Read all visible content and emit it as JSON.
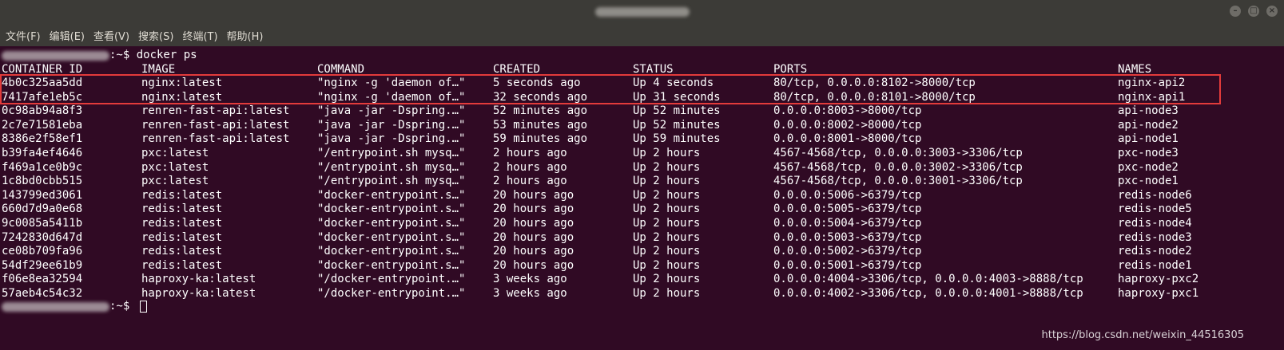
{
  "menu": [
    "文件(F)",
    "编辑(E)",
    "查看(V)",
    "搜索(S)",
    "终端(T)",
    "帮助(H)"
  ],
  "window_controls": {
    "minimize": "–",
    "maximize": "□",
    "close": "×"
  },
  "prompt": {
    "suffix": ":~$ ",
    "command": "docker ps"
  },
  "table": {
    "headers": [
      "CONTAINER ID",
      "IMAGE",
      "COMMAND",
      "CREATED",
      "STATUS",
      "PORTS",
      "NAMES"
    ],
    "rows": [
      [
        "4b0c325aa5dd",
        "nginx:latest",
        "\"nginx -g 'daemon of…\"",
        "5 seconds ago",
        "Up 4 seconds",
        "80/tcp, 0.0.0.0:8102->8000/tcp",
        "nginx-api2"
      ],
      [
        "7417afe1eb5c",
        "nginx:latest",
        "\"nginx -g 'daemon of…\"",
        "32 seconds ago",
        "Up 31 seconds",
        "80/tcp, 0.0.0.0:8101->8000/tcp",
        "nginx-api1"
      ],
      [
        "0c98ab94a8f3",
        "renren-fast-api:latest",
        "\"java -jar -Dspring.…\"",
        "52 minutes ago",
        "Up 52 minutes",
        "0.0.0.0:8003->8000/tcp",
        "api-node3"
      ],
      [
        "2c7e71581eba",
        "renren-fast-api:latest",
        "\"java -jar -Dspring.…\"",
        "53 minutes ago",
        "Up 52 minutes",
        "0.0.0.0:8002->8000/tcp",
        "api-node2"
      ],
      [
        "8386e2f58ef1",
        "renren-fast-api:latest",
        "\"java -jar -Dspring.…\"",
        "59 minutes ago",
        "Up 59 minutes",
        "0.0.0.0:8001->8000/tcp",
        "api-node1"
      ],
      [
        "b39fa4ef4646",
        "pxc:latest",
        "\"/entrypoint.sh mysq…\"",
        "2 hours ago",
        "Up 2 hours",
        "4567-4568/tcp, 0.0.0.0:3003->3306/tcp",
        "pxc-node3"
      ],
      [
        "f469a1ce0b9c",
        "pxc:latest",
        "\"/entrypoint.sh mysq…\"",
        "2 hours ago",
        "Up 2 hours",
        "4567-4568/tcp, 0.0.0.0:3002->3306/tcp",
        "pxc-node2"
      ],
      [
        "1c8bd0cbb515",
        "pxc:latest",
        "\"/entrypoint.sh mysq…\"",
        "2 hours ago",
        "Up 2 hours",
        "4567-4568/tcp, 0.0.0.0:3001->3306/tcp",
        "pxc-node1"
      ],
      [
        "143799ed3061",
        "redis:latest",
        "\"docker-entrypoint.s…\"",
        "20 hours ago",
        "Up 2 hours",
        "0.0.0.0:5006->6379/tcp",
        "redis-node6"
      ],
      [
        "660d7d9a0e68",
        "redis:latest",
        "\"docker-entrypoint.s…\"",
        "20 hours ago",
        "Up 2 hours",
        "0.0.0.0:5005->6379/tcp",
        "redis-node5"
      ],
      [
        "9c0085a5411b",
        "redis:latest",
        "\"docker-entrypoint.s…\"",
        "20 hours ago",
        "Up 2 hours",
        "0.0.0.0:5004->6379/tcp",
        "redis-node4"
      ],
      [
        "7242830d647d",
        "redis:latest",
        "\"docker-entrypoint.s…\"",
        "20 hours ago",
        "Up 2 hours",
        "0.0.0.0:5003->6379/tcp",
        "redis-node3"
      ],
      [
        "ce08b709fa96",
        "redis:latest",
        "\"docker-entrypoint.s…\"",
        "20 hours ago",
        "Up 2 hours",
        "0.0.0.0:5002->6379/tcp",
        "redis-node2"
      ],
      [
        "54df29ee61b9",
        "redis:latest",
        "\"docker-entrypoint.s…\"",
        "20 hours ago",
        "Up 2 hours",
        "0.0.0.0:5001->6379/tcp",
        "redis-node1"
      ],
      [
        "f06e8ea32594",
        "haproxy-ka:latest",
        "\"/docker-entrypoint.…\"",
        "3 weeks ago",
        "Up 2 hours",
        "0.0.0.0:4004->3306/tcp, 0.0.0.0:4003->8888/tcp",
        "haproxy-pxc2"
      ],
      [
        "57aeb4c54c32",
        "haproxy-ka:latest",
        "\"/docker-entrypoint.…\"",
        "3 weeks ago",
        "Up 2 hours",
        "0.0.0.0:4002->3306/tcp, 0.0.0.0:4001->8888/tcp",
        "haproxy-pxc1"
      ]
    ]
  },
  "watermark": "https://blog.csdn.net/weixin_44516305",
  "colors": {
    "terminal_bg": "#300a24",
    "highlight_border": "#e33b3b",
    "menubar_bg": "#3c3b37"
  }
}
